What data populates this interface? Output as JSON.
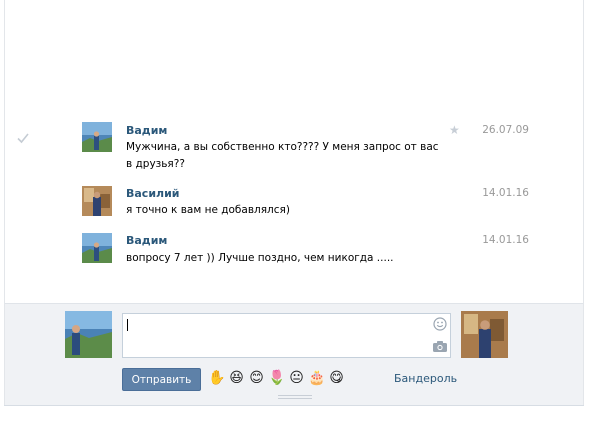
{
  "messages": [
    {
      "author": "Вадим",
      "text": "Мужчина, а вы собственно кто???? У меня запрос от вас в друзья??",
      "date": "26.07.09",
      "read_check": true,
      "starred": true
    },
    {
      "author": "Василий",
      "text": "я точно к вам не добавлялся)",
      "date": "14.01.16"
    },
    {
      "author": "Вадим",
      "text": "вопросу 7 лет )) Лучше поздно, чем никогда .....",
      "date": "14.01.16"
    }
  ],
  "composer": {
    "input_value": "",
    "send_label": "Отправить",
    "bandarol_label": "Бандероль",
    "emoji": [
      "hand-icon",
      "laughing-icon",
      "grin-icon",
      "flower-icon",
      "neutral-face-icon",
      "cake-icon",
      "tongue-face-icon"
    ],
    "emoji_glyphs": [
      "✋",
      "😆",
      "😊",
      "🌷",
      "😐",
      "🎂",
      "😋"
    ]
  },
  "colors": {
    "author": "#2b587a",
    "send_button": "#5e81a8",
    "composer_bg": "#f0f2f5"
  }
}
